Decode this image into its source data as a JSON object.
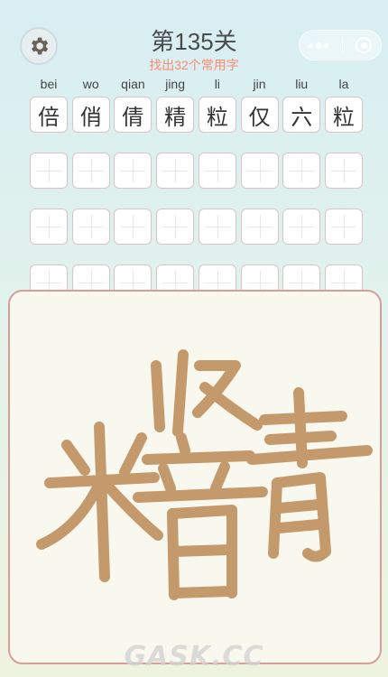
{
  "header": {
    "title": "第135关",
    "subtitle": "找出32个常用字"
  },
  "grid": {
    "pinyin": [
      "bei",
      "wo",
      "qian",
      "jing",
      "li",
      "jin",
      "liu",
      "la"
    ],
    "found": [
      "倍",
      "俏",
      "倩",
      "精",
      "粒",
      "仅",
      "六",
      "粒"
    ]
  },
  "board": {
    "components": [
      "米",
      "臤",
      "音",
      "青"
    ]
  },
  "icons": {
    "settings": "gear-icon",
    "menu": "more-dots-icon",
    "close": "target-icon"
  },
  "watermark": "GASK.CC",
  "colors": {
    "subtitle": "#ff8a73",
    "stroke": "#c49a6c",
    "board_border": "#d79f98"
  }
}
